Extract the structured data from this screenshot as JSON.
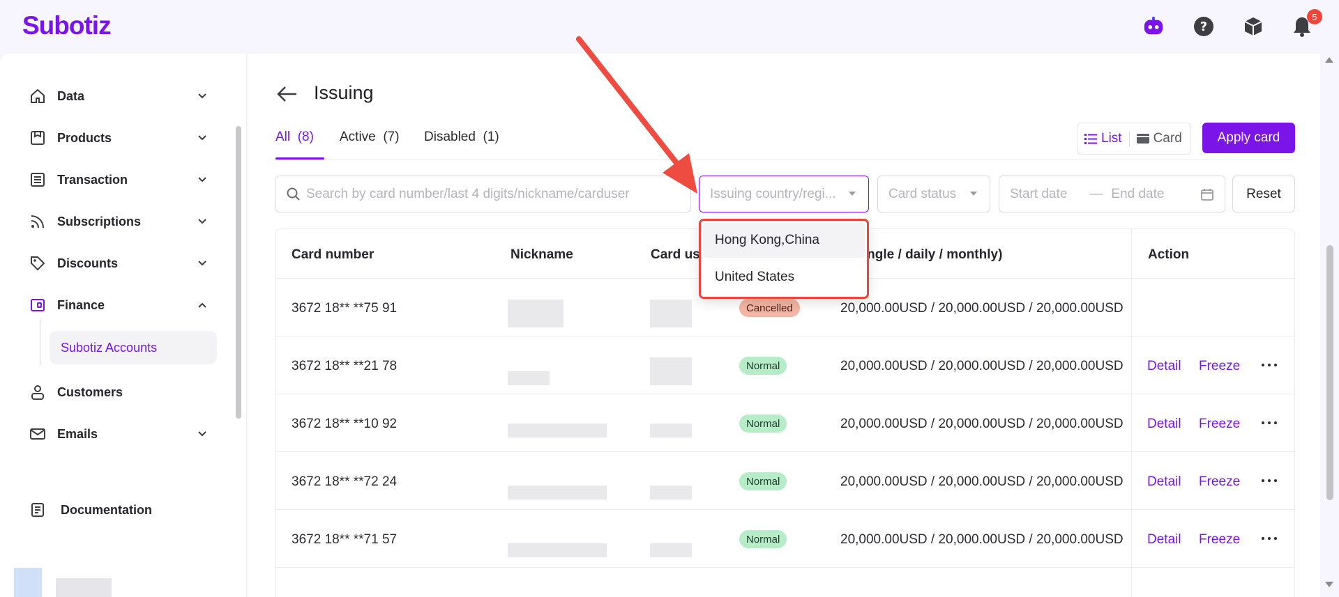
{
  "app": {
    "logo": "Subotiz",
    "notification_count": "5"
  },
  "sidebar": {
    "items": [
      {
        "label": "Data",
        "icon": "home-icon",
        "expandable": true
      },
      {
        "label": "Products",
        "icon": "box-icon",
        "expandable": true
      },
      {
        "label": "Transaction",
        "icon": "list-icon",
        "expandable": true
      },
      {
        "label": "Subscriptions",
        "icon": "rss-icon",
        "expandable": true
      },
      {
        "label": "Discounts",
        "icon": "tag-icon",
        "expandable": true
      },
      {
        "label": "Finance",
        "icon": "wallet-icon",
        "expanded": true
      },
      {
        "label": "Customers",
        "icon": "user-icon",
        "expandable": false
      },
      {
        "label": "Emails",
        "icon": "mail-icon",
        "expandable": true
      }
    ],
    "active_subitem": "Subotiz Accounts",
    "documentation": "Documentation"
  },
  "page": {
    "title": "Issuing",
    "tabs": [
      {
        "label": "All",
        "count": "(8)",
        "active": true
      },
      {
        "label": "Active",
        "count": "(7)"
      },
      {
        "label": "Disabled",
        "count": "(1)"
      }
    ],
    "view_toggle": {
      "list": "List",
      "card": "Card"
    },
    "apply_button": "Apply card"
  },
  "filters": {
    "search_placeholder": "Search by card number/last 4 digits/nickname/carduser",
    "country_placeholder": "Issuing country/regi...",
    "status_placeholder": "Card status",
    "start_date": "Start date",
    "end_date": "End date",
    "reset": "Reset"
  },
  "country_dropdown": {
    "options": [
      "Hong Kong,China",
      "United States"
    ]
  },
  "table": {
    "headers": {
      "card_number": "Card number",
      "nickname": "Nickname",
      "card_user": "Card use",
      "limit": "(single / daily / monthly)",
      "action": "Action"
    },
    "rows": [
      {
        "card_number": "3672 18** **75 91",
        "status": "Cancelled",
        "status_type": "cancelled",
        "limit": "20,000.00USD / 20,000.00USD / 20,000.00USD",
        "actions": false
      },
      {
        "card_number": "3672 18** **21 78",
        "status": "Normal",
        "status_type": "normal",
        "limit": "20,000.00USD / 20,000.00USD / 20,000.00USD",
        "actions": true
      },
      {
        "card_number": "3672 18** **10 92",
        "status": "Normal",
        "status_type": "normal",
        "limit": "20,000.00USD / 20,000.00USD / 20,000.00USD",
        "actions": true
      },
      {
        "card_number": "3672 18** **72 24",
        "status": "Normal",
        "status_type": "normal",
        "limit": "20,000.00USD / 20,000.00USD / 20,000.00USD",
        "actions": true
      },
      {
        "card_number": "3672 18** **71 57",
        "status": "Normal",
        "status_type": "normal",
        "limit": "20,000.00USD / 20,000.00USD / 20,000.00USD",
        "actions": true
      }
    ],
    "action_labels": {
      "detail": "Detail",
      "freeze": "Freeze"
    }
  },
  "colors": {
    "accent": "#7a14e8",
    "highlight": "#e8463e",
    "normal_badge": "#b7ecc8",
    "cancelled_badge": "#f4b6a4"
  }
}
